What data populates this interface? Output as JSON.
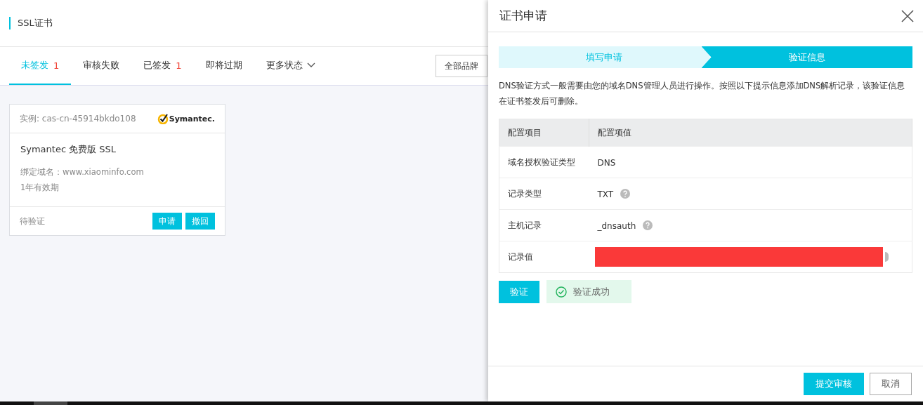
{
  "page": {
    "title": "SSL证书",
    "tabs": [
      {
        "label": "未签发",
        "count": "1",
        "selected": true
      },
      {
        "label": "审核失败",
        "selected": false
      },
      {
        "label": "已签发",
        "count": "1",
        "selected": false
      },
      {
        "label": "即将过期",
        "selected": false
      },
      {
        "label": "更多状态",
        "dropdown": true,
        "selected": false
      }
    ],
    "brand_filter": "全部品牌",
    "cards": [
      {
        "instance": "实例: cas-cn-45914bkdo108",
        "brand_logo": "Symantec.",
        "product": "Symantec 免费版 SSL",
        "domain": "绑定域名：www.xiaominfo.com",
        "validity": "1年有效期",
        "status": "待验证",
        "actions": [
          "申请",
          "撤回"
        ]
      }
    ]
  },
  "drawer": {
    "title": "证书申请",
    "steps": [
      {
        "label": "填写申请",
        "selected": false
      },
      {
        "label": "验证信息",
        "selected": true
      }
    ],
    "description": "DNS验证方式一般需要由您的域名DNS管理人员进行操作。按照以下提示信息添加DNS解析记录，该验证信息在证书签发后可删除。",
    "table": {
      "columns": [
        "配置项目",
        "配置项值"
      ],
      "rows": [
        {
          "item": "域名授权验证类型",
          "value": "DNS",
          "help": false,
          "redacted": false
        },
        {
          "item": "记录类型",
          "value": "TXT",
          "help": true,
          "redacted": false
        },
        {
          "item": "主机记录",
          "value": "_dnsauth",
          "help": true,
          "redacted": false
        },
        {
          "item": "记录值",
          "help": true,
          "redacted": true
        }
      ]
    },
    "verify_button": "验证",
    "verify_result": {
      "text": "验证成功",
      "success": true
    },
    "footer_buttons": [
      {
        "label": "提交审核",
        "primary": true
      },
      {
        "label": "取消",
        "primary": false
      }
    ]
  }
}
